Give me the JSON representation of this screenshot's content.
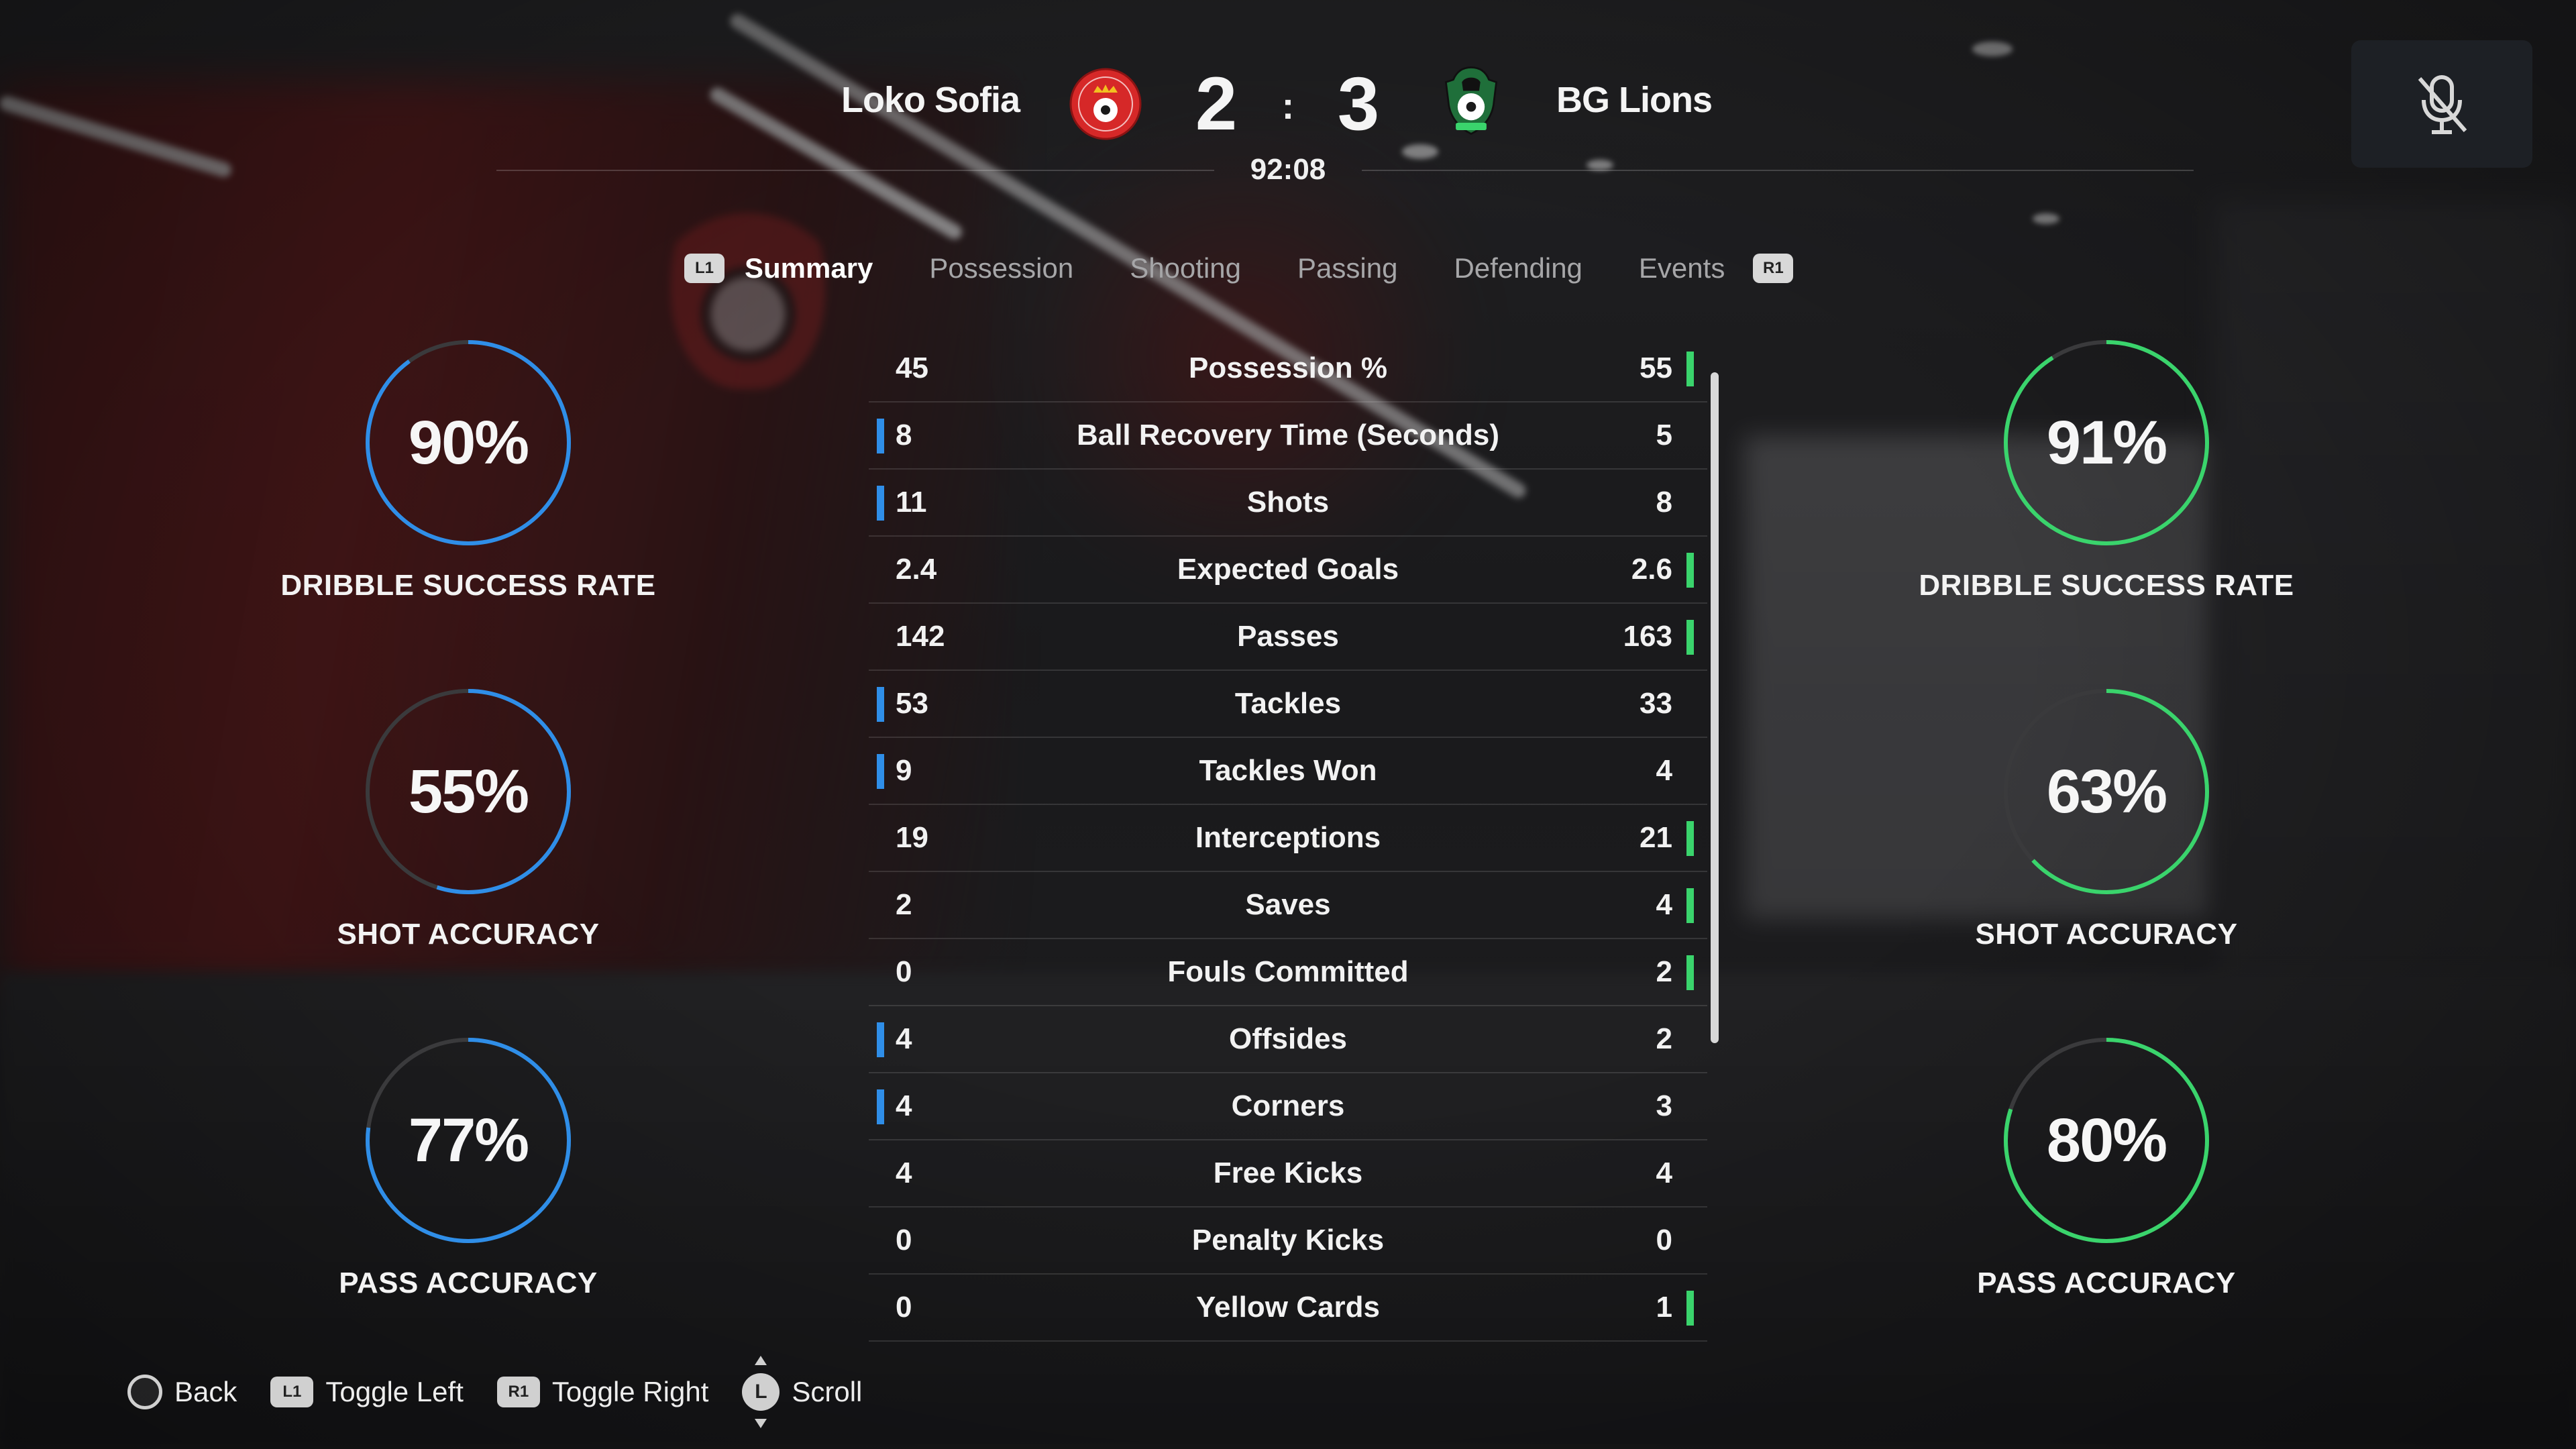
{
  "header": {
    "home_team": "Loko Sofia",
    "away_team": "BG Lions",
    "home_score": "2",
    "score_separator": ":",
    "away_score": "3",
    "match_clock": "92:08",
    "mute_icon": "microphone-muted-icon"
  },
  "tabs": {
    "left_badge": "L1",
    "right_badge": "R1",
    "items": [
      "Summary",
      "Possession",
      "Shooting",
      "Passing",
      "Defending",
      "Events"
    ],
    "active": "Summary"
  },
  "colors": {
    "home": "#2f8ee8",
    "away": "#3ad46c",
    "ring_track": "#3a3a3c"
  },
  "home_rings": [
    {
      "value": "90%",
      "percent": 90,
      "label": "DRIBBLE SUCCESS RATE"
    },
    {
      "value": "55%",
      "percent": 55,
      "label": "SHOT ACCURACY"
    },
    {
      "value": "77%",
      "percent": 77,
      "label": "PASS ACCURACY"
    }
  ],
  "away_rings": [
    {
      "value": "91%",
      "percent": 91,
      "label": "DRIBBLE SUCCESS RATE"
    },
    {
      "value": "63%",
      "percent": 63,
      "label": "SHOT ACCURACY"
    },
    {
      "value": "80%",
      "percent": 80,
      "label": "PASS ACCURACY"
    }
  ],
  "stats": [
    {
      "label": "Possession %",
      "home": "45",
      "away": "55",
      "leader": "away"
    },
    {
      "label": "Ball Recovery Time (Seconds)",
      "home": "8",
      "away": "5",
      "leader": "home"
    },
    {
      "label": "Shots",
      "home": "11",
      "away": "8",
      "leader": "home"
    },
    {
      "label": "Expected Goals",
      "home": "2.4",
      "away": "2.6",
      "leader": "away"
    },
    {
      "label": "Passes",
      "home": "142",
      "away": "163",
      "leader": "away"
    },
    {
      "label": "Tackles",
      "home": "53",
      "away": "33",
      "leader": "home"
    },
    {
      "label": "Tackles Won",
      "home": "9",
      "away": "4",
      "leader": "home"
    },
    {
      "label": "Interceptions",
      "home": "19",
      "away": "21",
      "leader": "away"
    },
    {
      "label": "Saves",
      "home": "2",
      "away": "4",
      "leader": "away"
    },
    {
      "label": "Fouls Committed",
      "home": "0",
      "away": "2",
      "leader": "away"
    },
    {
      "label": "Offsides",
      "home": "4",
      "away": "2",
      "leader": "home"
    },
    {
      "label": "Corners",
      "home": "4",
      "away": "3",
      "leader": "home"
    },
    {
      "label": "Free Kicks",
      "home": "4",
      "away": "4",
      "leader": "none"
    },
    {
      "label": "Penalty Kicks",
      "home": "0",
      "away": "0",
      "leader": "none"
    },
    {
      "label": "Yellow Cards",
      "home": "0",
      "away": "1",
      "leader": "away"
    }
  ],
  "footer": {
    "back": {
      "icon": "circle-button-icon",
      "label": "Back"
    },
    "toggle_left": {
      "badge": "L1",
      "label": "Toggle Left"
    },
    "toggle_right": {
      "badge": "R1",
      "label": "Toggle Right"
    },
    "scroll": {
      "badge": "L",
      "label": "Scroll"
    }
  }
}
